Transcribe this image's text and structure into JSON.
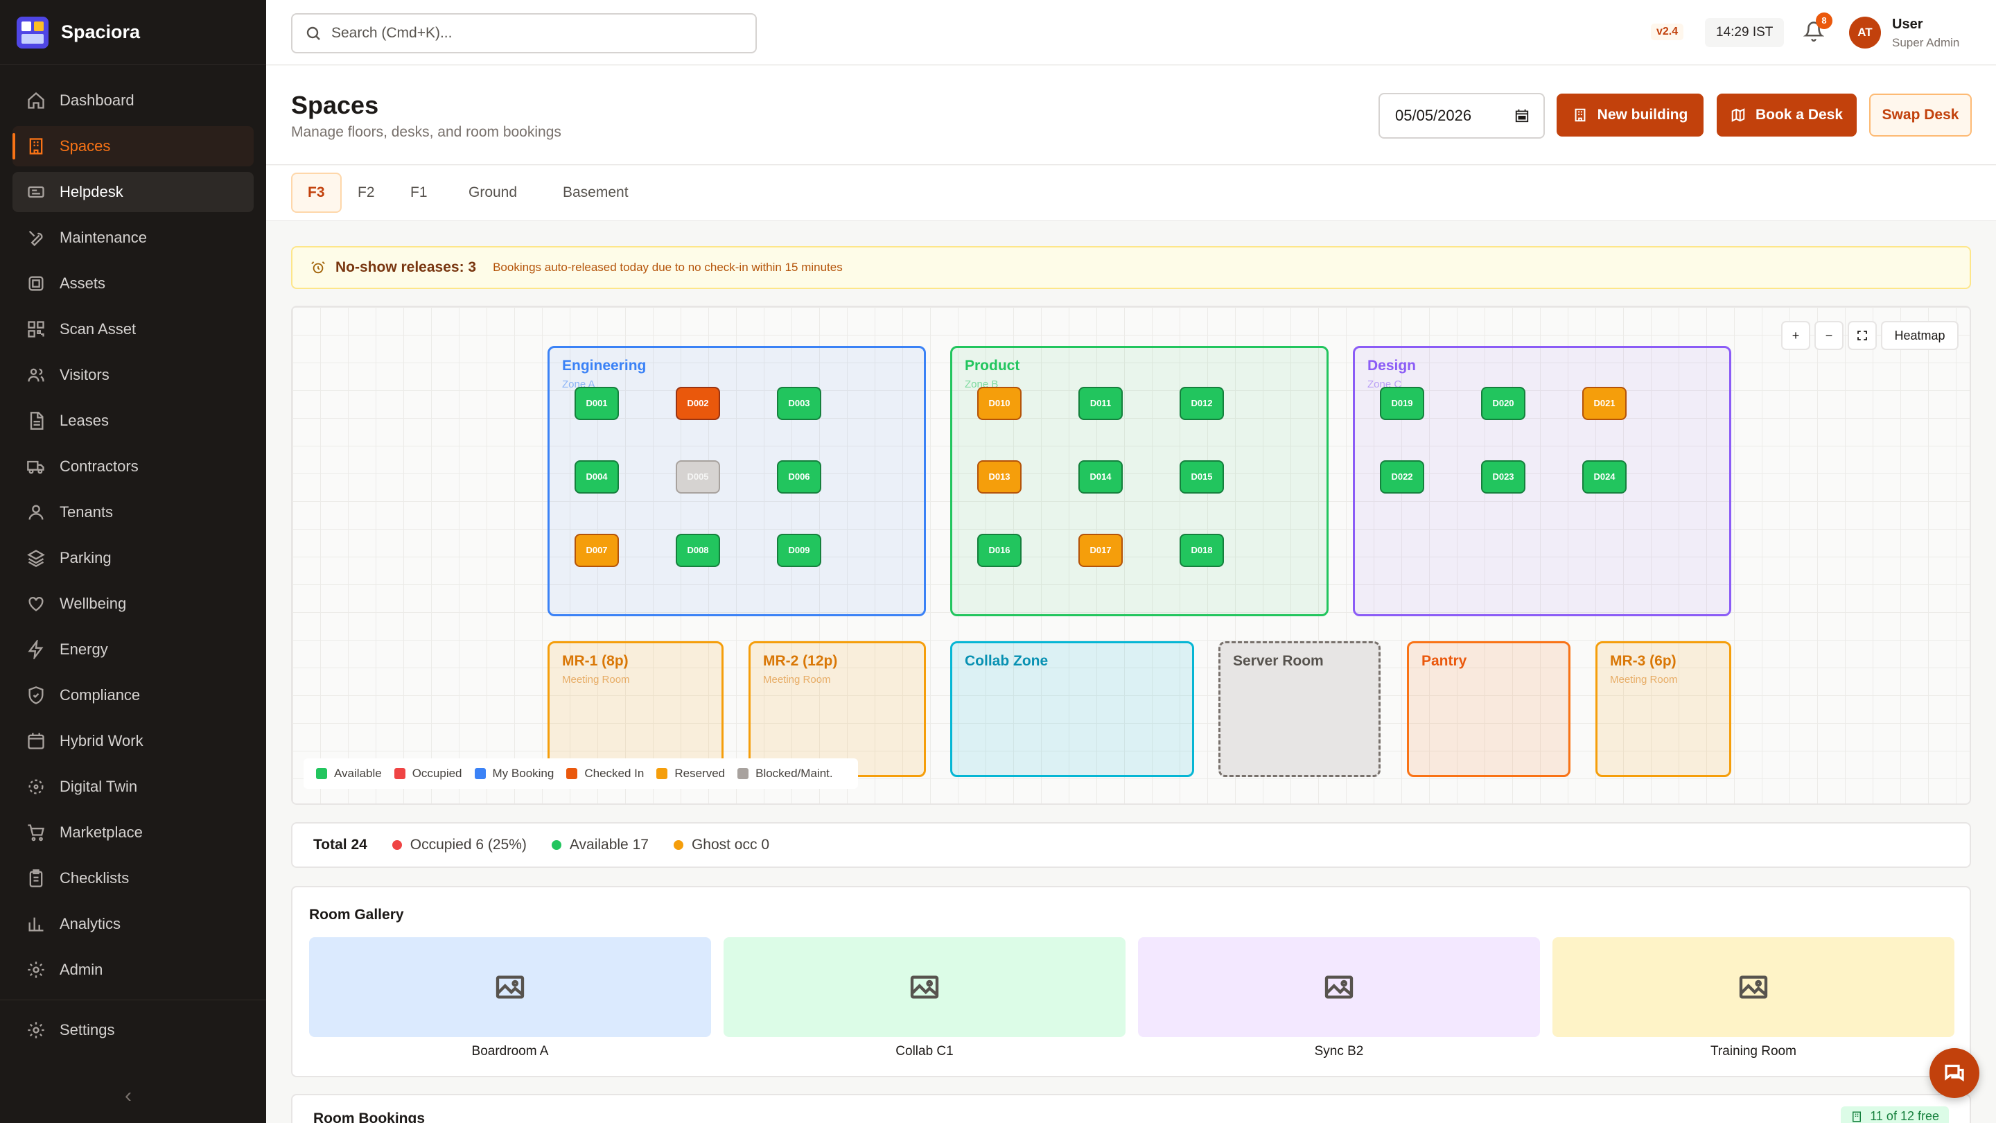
{
  "app": {
    "name": "Spaciora",
    "version": "v2.4",
    "time": "14:29 IST",
    "notifications": "8"
  },
  "user": {
    "initials": "AT",
    "name": "User",
    "role": "Super Admin"
  },
  "search": {
    "placeholder": "Search (Cmd+K)..."
  },
  "nav": {
    "items": [
      {
        "label": "Dashboard",
        "icon": "home-icon"
      },
      {
        "label": "Spaces",
        "icon": "building-icon"
      },
      {
        "label": "Helpdesk",
        "icon": "ticket-icon"
      },
      {
        "label": "Maintenance",
        "icon": "wrench-icon"
      },
      {
        "label": "Assets",
        "icon": "box-icon"
      },
      {
        "label": "Scan Asset",
        "icon": "qr-icon"
      },
      {
        "label": "Visitors",
        "icon": "visitors-icon"
      },
      {
        "label": "Leases",
        "icon": "file-icon"
      },
      {
        "label": "Contractors",
        "icon": "truck-icon"
      },
      {
        "label": "Tenants",
        "icon": "user-icon"
      },
      {
        "label": "Parking",
        "icon": "layers-icon"
      },
      {
        "label": "Wellbeing",
        "icon": "heart-icon"
      },
      {
        "label": "Energy",
        "icon": "bolt-icon"
      },
      {
        "label": "Compliance",
        "icon": "shield-icon"
      },
      {
        "label": "Hybrid Work",
        "icon": "calendar-icon"
      },
      {
        "label": "Digital Twin",
        "icon": "twin-icon"
      },
      {
        "label": "Marketplace",
        "icon": "cart-icon"
      },
      {
        "label": "Checklists",
        "icon": "clipboard-icon"
      },
      {
        "label": "Analytics",
        "icon": "chart-icon"
      },
      {
        "label": "Admin",
        "icon": "gear-icon"
      }
    ],
    "settings": "Settings",
    "active": "Spaces",
    "highlighted": "Helpdesk"
  },
  "page": {
    "title": "Spaces",
    "subtitle": "Manage floors, desks, and room bookings",
    "date": "05/05/2026"
  },
  "actions": {
    "new_building": "New building",
    "book_desk": "Book a Desk",
    "swap_desk": "Swap Desk"
  },
  "floors": {
    "tabs": [
      "F3",
      "F2",
      "F1",
      "Ground",
      "Basement"
    ],
    "active": "F3"
  },
  "banner": {
    "title": "No-show releases: 3",
    "text": "Bookings auto-released today due to no check-in within 15 minutes"
  },
  "map": {
    "controls": {
      "zoom_in": "+",
      "zoom_out": "−",
      "heatmap": "Heatmap"
    },
    "zones": [
      {
        "name": "Engineering",
        "sub": "Zone A",
        "color": "#3b82f6",
        "desks": [
          [
            "D001",
            "available"
          ],
          [
            "D002",
            "occupied-checked"
          ],
          [
            "D003",
            "available"
          ],
          [
            "D004",
            "available"
          ],
          [
            "D005",
            "blocked"
          ],
          [
            "D006",
            "available"
          ],
          [
            "D007",
            "reserved"
          ],
          [
            "D008",
            "available"
          ],
          [
            "D009",
            "available"
          ]
        ]
      },
      {
        "name": "Product",
        "sub": "Zone B",
        "color": "#22c55e",
        "desks": [
          [
            "D010",
            "reserved"
          ],
          [
            "D011",
            "available"
          ],
          [
            "D012",
            "available"
          ],
          [
            "D013",
            "reserved"
          ],
          [
            "D014",
            "available"
          ],
          [
            "D015",
            "available"
          ],
          [
            "D016",
            "available"
          ],
          [
            "D017",
            "reserved"
          ],
          [
            "D018",
            "available"
          ]
        ]
      },
      {
        "name": "Design",
        "sub": "Zone C",
        "color": "#8b5cf6",
        "desks": [
          [
            "D019",
            "available"
          ],
          [
            "D020",
            "available"
          ],
          [
            "D021",
            "reserved"
          ],
          [
            "D022",
            "available"
          ],
          [
            "D023",
            "available"
          ],
          [
            "D024",
            "available"
          ]
        ]
      }
    ],
    "rooms": [
      {
        "name": "MR-1 (8p)",
        "sub": "Meeting Room",
        "color": "#f59e0b"
      },
      {
        "name": "MR-2 (12p)",
        "sub": "Meeting Room",
        "color": "#f59e0b"
      },
      {
        "name": "Collab Zone",
        "sub": "",
        "color": "#06b6d4"
      },
      {
        "name": "Server Room",
        "sub": "",
        "color": "#78716c"
      },
      {
        "name": "Pantry",
        "sub": "",
        "color": "#f97316"
      },
      {
        "name": "MR-3 (6p)",
        "sub": "Meeting Room",
        "color": "#f59e0b"
      }
    ],
    "legend": [
      {
        "label": "Available",
        "color": "#22c55e"
      },
      {
        "label": "Occupied",
        "color": "#ef4444"
      },
      {
        "label": "My Booking",
        "color": "#3b82f6"
      },
      {
        "label": "Checked In",
        "color": "#ea580c"
      },
      {
        "label": "Reserved",
        "color": "#f59e0b"
      },
      {
        "label": "Blocked/Maint.",
        "color": "#a8a29e"
      }
    ]
  },
  "stats": {
    "total": "Total 24",
    "occupied": "Occupied 6 (25%)",
    "available": "Available 17",
    "ghost": "Ghost occ 0"
  },
  "gallery": {
    "title": "Room Gallery",
    "items": [
      {
        "label": "Boardroom A",
        "color": "#dbeafe"
      },
      {
        "label": "Collab C1",
        "color": "#dcfce7"
      },
      {
        "label": "Sync B2",
        "color": "#f3e8ff"
      },
      {
        "label": "Training Room",
        "color": "#fef3c7"
      }
    ]
  },
  "bookings": {
    "title": "Room Bookings",
    "free": "11 of 12 free"
  }
}
